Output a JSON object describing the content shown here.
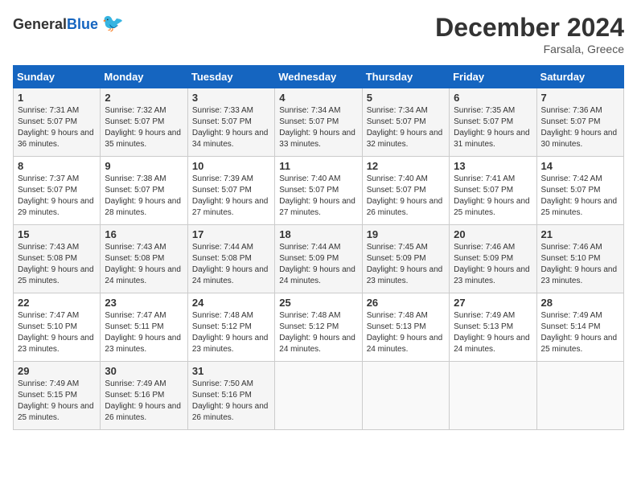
{
  "header": {
    "logo_general": "General",
    "logo_blue": "Blue",
    "month": "December 2024",
    "location": "Farsala, Greece"
  },
  "days_of_week": [
    "Sunday",
    "Monday",
    "Tuesday",
    "Wednesday",
    "Thursday",
    "Friday",
    "Saturday"
  ],
  "weeks": [
    [
      {
        "day": "1",
        "sunrise": "7:31 AM",
        "sunset": "5:07 PM",
        "daylight": "9 hours and 36 minutes."
      },
      {
        "day": "2",
        "sunrise": "7:32 AM",
        "sunset": "5:07 PM",
        "daylight": "9 hours and 35 minutes."
      },
      {
        "day": "3",
        "sunrise": "7:33 AM",
        "sunset": "5:07 PM",
        "daylight": "9 hours and 34 minutes."
      },
      {
        "day": "4",
        "sunrise": "7:34 AM",
        "sunset": "5:07 PM",
        "daylight": "9 hours and 33 minutes."
      },
      {
        "day": "5",
        "sunrise": "7:34 AM",
        "sunset": "5:07 PM",
        "daylight": "9 hours and 32 minutes."
      },
      {
        "day": "6",
        "sunrise": "7:35 AM",
        "sunset": "5:07 PM",
        "daylight": "9 hours and 31 minutes."
      },
      {
        "day": "7",
        "sunrise": "7:36 AM",
        "sunset": "5:07 PM",
        "daylight": "9 hours and 30 minutes."
      }
    ],
    [
      {
        "day": "8",
        "sunrise": "7:37 AM",
        "sunset": "5:07 PM",
        "daylight": "9 hours and 29 minutes."
      },
      {
        "day": "9",
        "sunrise": "7:38 AM",
        "sunset": "5:07 PM",
        "daylight": "9 hours and 28 minutes."
      },
      {
        "day": "10",
        "sunrise": "7:39 AM",
        "sunset": "5:07 PM",
        "daylight": "9 hours and 27 minutes."
      },
      {
        "day": "11",
        "sunrise": "7:40 AM",
        "sunset": "5:07 PM",
        "daylight": "9 hours and 27 minutes."
      },
      {
        "day": "12",
        "sunrise": "7:40 AM",
        "sunset": "5:07 PM",
        "daylight": "9 hours and 26 minutes."
      },
      {
        "day": "13",
        "sunrise": "7:41 AM",
        "sunset": "5:07 PM",
        "daylight": "9 hours and 25 minutes."
      },
      {
        "day": "14",
        "sunrise": "7:42 AM",
        "sunset": "5:07 PM",
        "daylight": "9 hours and 25 minutes."
      }
    ],
    [
      {
        "day": "15",
        "sunrise": "7:43 AM",
        "sunset": "5:08 PM",
        "daylight": "9 hours and 25 minutes."
      },
      {
        "day": "16",
        "sunrise": "7:43 AM",
        "sunset": "5:08 PM",
        "daylight": "9 hours and 24 minutes."
      },
      {
        "day": "17",
        "sunrise": "7:44 AM",
        "sunset": "5:08 PM",
        "daylight": "9 hours and 24 minutes."
      },
      {
        "day": "18",
        "sunrise": "7:44 AM",
        "sunset": "5:09 PM",
        "daylight": "9 hours and 24 minutes."
      },
      {
        "day": "19",
        "sunrise": "7:45 AM",
        "sunset": "5:09 PM",
        "daylight": "9 hours and 23 minutes."
      },
      {
        "day": "20",
        "sunrise": "7:46 AM",
        "sunset": "5:09 PM",
        "daylight": "9 hours and 23 minutes."
      },
      {
        "day": "21",
        "sunrise": "7:46 AM",
        "sunset": "5:10 PM",
        "daylight": "9 hours and 23 minutes."
      }
    ],
    [
      {
        "day": "22",
        "sunrise": "7:47 AM",
        "sunset": "5:10 PM",
        "daylight": "9 hours and 23 minutes."
      },
      {
        "day": "23",
        "sunrise": "7:47 AM",
        "sunset": "5:11 PM",
        "daylight": "9 hours and 23 minutes."
      },
      {
        "day": "24",
        "sunrise": "7:48 AM",
        "sunset": "5:12 PM",
        "daylight": "9 hours and 23 minutes."
      },
      {
        "day": "25",
        "sunrise": "7:48 AM",
        "sunset": "5:12 PM",
        "daylight": "9 hours and 24 minutes."
      },
      {
        "day": "26",
        "sunrise": "7:48 AM",
        "sunset": "5:13 PM",
        "daylight": "9 hours and 24 minutes."
      },
      {
        "day": "27",
        "sunrise": "7:49 AM",
        "sunset": "5:13 PM",
        "daylight": "9 hours and 24 minutes."
      },
      {
        "day": "28",
        "sunrise": "7:49 AM",
        "sunset": "5:14 PM",
        "daylight": "9 hours and 25 minutes."
      }
    ],
    [
      {
        "day": "29",
        "sunrise": "7:49 AM",
        "sunset": "5:15 PM",
        "daylight": "9 hours and 25 minutes."
      },
      {
        "day": "30",
        "sunrise": "7:49 AM",
        "sunset": "5:16 PM",
        "daylight": "9 hours and 26 minutes."
      },
      {
        "day": "31",
        "sunrise": "7:50 AM",
        "sunset": "5:16 PM",
        "daylight": "9 hours and 26 minutes."
      },
      null,
      null,
      null,
      null
    ]
  ]
}
